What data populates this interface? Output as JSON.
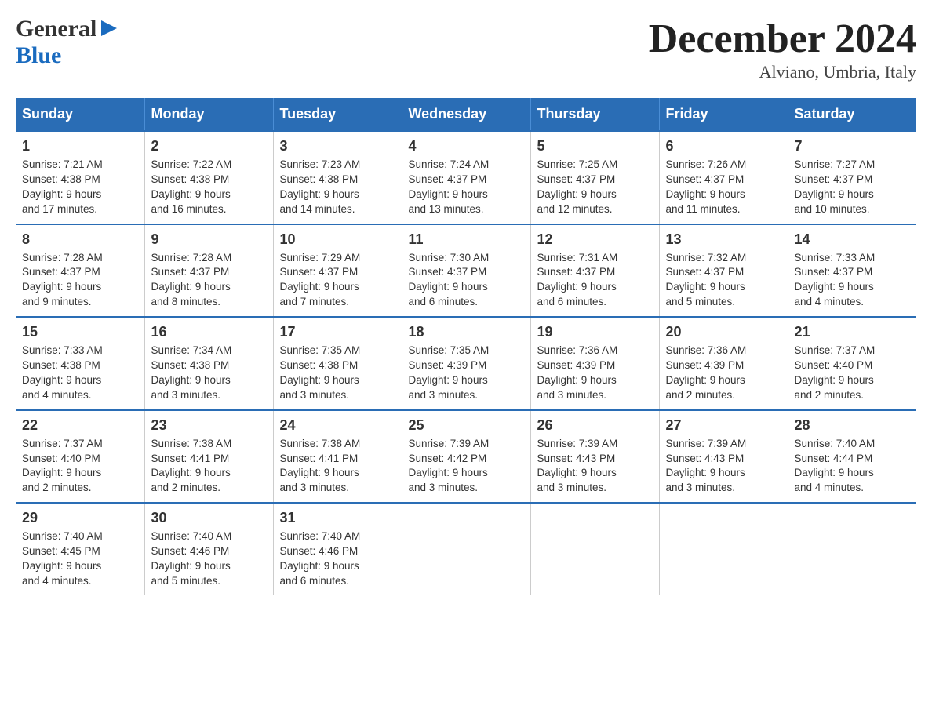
{
  "header": {
    "logo_general": "General",
    "logo_blue": "Blue",
    "title": "December 2024",
    "subtitle": "Alviano, Umbria, Italy"
  },
  "days_of_week": [
    "Sunday",
    "Monday",
    "Tuesday",
    "Wednesday",
    "Thursday",
    "Friday",
    "Saturday"
  ],
  "weeks": [
    [
      {
        "day": "1",
        "sunrise": "7:21 AM",
        "sunset": "4:38 PM",
        "daylight": "9 hours and 17 minutes."
      },
      {
        "day": "2",
        "sunrise": "7:22 AM",
        "sunset": "4:38 PM",
        "daylight": "9 hours and 16 minutes."
      },
      {
        "day": "3",
        "sunrise": "7:23 AM",
        "sunset": "4:38 PM",
        "daylight": "9 hours and 14 minutes."
      },
      {
        "day": "4",
        "sunrise": "7:24 AM",
        "sunset": "4:37 PM",
        "daylight": "9 hours and 13 minutes."
      },
      {
        "day": "5",
        "sunrise": "7:25 AM",
        "sunset": "4:37 PM",
        "daylight": "9 hours and 12 minutes."
      },
      {
        "day": "6",
        "sunrise": "7:26 AM",
        "sunset": "4:37 PM",
        "daylight": "9 hours and 11 minutes."
      },
      {
        "day": "7",
        "sunrise": "7:27 AM",
        "sunset": "4:37 PM",
        "daylight": "9 hours and 10 minutes."
      }
    ],
    [
      {
        "day": "8",
        "sunrise": "7:28 AM",
        "sunset": "4:37 PM",
        "daylight": "9 hours and 9 minutes."
      },
      {
        "day": "9",
        "sunrise": "7:28 AM",
        "sunset": "4:37 PM",
        "daylight": "9 hours and 8 minutes."
      },
      {
        "day": "10",
        "sunrise": "7:29 AM",
        "sunset": "4:37 PM",
        "daylight": "9 hours and 7 minutes."
      },
      {
        "day": "11",
        "sunrise": "7:30 AM",
        "sunset": "4:37 PM",
        "daylight": "9 hours and 6 minutes."
      },
      {
        "day": "12",
        "sunrise": "7:31 AM",
        "sunset": "4:37 PM",
        "daylight": "9 hours and 6 minutes."
      },
      {
        "day": "13",
        "sunrise": "7:32 AM",
        "sunset": "4:37 PM",
        "daylight": "9 hours and 5 minutes."
      },
      {
        "day": "14",
        "sunrise": "7:33 AM",
        "sunset": "4:37 PM",
        "daylight": "9 hours and 4 minutes."
      }
    ],
    [
      {
        "day": "15",
        "sunrise": "7:33 AM",
        "sunset": "4:38 PM",
        "daylight": "9 hours and 4 minutes."
      },
      {
        "day": "16",
        "sunrise": "7:34 AM",
        "sunset": "4:38 PM",
        "daylight": "9 hours and 3 minutes."
      },
      {
        "day": "17",
        "sunrise": "7:35 AM",
        "sunset": "4:38 PM",
        "daylight": "9 hours and 3 minutes."
      },
      {
        "day": "18",
        "sunrise": "7:35 AM",
        "sunset": "4:39 PM",
        "daylight": "9 hours and 3 minutes."
      },
      {
        "day": "19",
        "sunrise": "7:36 AM",
        "sunset": "4:39 PM",
        "daylight": "9 hours and 3 minutes."
      },
      {
        "day": "20",
        "sunrise": "7:36 AM",
        "sunset": "4:39 PM",
        "daylight": "9 hours and 2 minutes."
      },
      {
        "day": "21",
        "sunrise": "7:37 AM",
        "sunset": "4:40 PM",
        "daylight": "9 hours and 2 minutes."
      }
    ],
    [
      {
        "day": "22",
        "sunrise": "7:37 AM",
        "sunset": "4:40 PM",
        "daylight": "9 hours and 2 minutes."
      },
      {
        "day": "23",
        "sunrise": "7:38 AM",
        "sunset": "4:41 PM",
        "daylight": "9 hours and 2 minutes."
      },
      {
        "day": "24",
        "sunrise": "7:38 AM",
        "sunset": "4:41 PM",
        "daylight": "9 hours and 3 minutes."
      },
      {
        "day": "25",
        "sunrise": "7:39 AM",
        "sunset": "4:42 PM",
        "daylight": "9 hours and 3 minutes."
      },
      {
        "day": "26",
        "sunrise": "7:39 AM",
        "sunset": "4:43 PM",
        "daylight": "9 hours and 3 minutes."
      },
      {
        "day": "27",
        "sunrise": "7:39 AM",
        "sunset": "4:43 PM",
        "daylight": "9 hours and 3 minutes."
      },
      {
        "day": "28",
        "sunrise": "7:40 AM",
        "sunset": "4:44 PM",
        "daylight": "9 hours and 4 minutes."
      }
    ],
    [
      {
        "day": "29",
        "sunrise": "7:40 AM",
        "sunset": "4:45 PM",
        "daylight": "9 hours and 4 minutes."
      },
      {
        "day": "30",
        "sunrise": "7:40 AM",
        "sunset": "4:46 PM",
        "daylight": "9 hours and 5 minutes."
      },
      {
        "day": "31",
        "sunrise": "7:40 AM",
        "sunset": "4:46 PM",
        "daylight": "9 hours and 6 minutes."
      },
      null,
      null,
      null,
      null
    ]
  ],
  "labels": {
    "sunrise": "Sunrise:",
    "sunset": "Sunset:",
    "daylight": "Daylight:"
  }
}
